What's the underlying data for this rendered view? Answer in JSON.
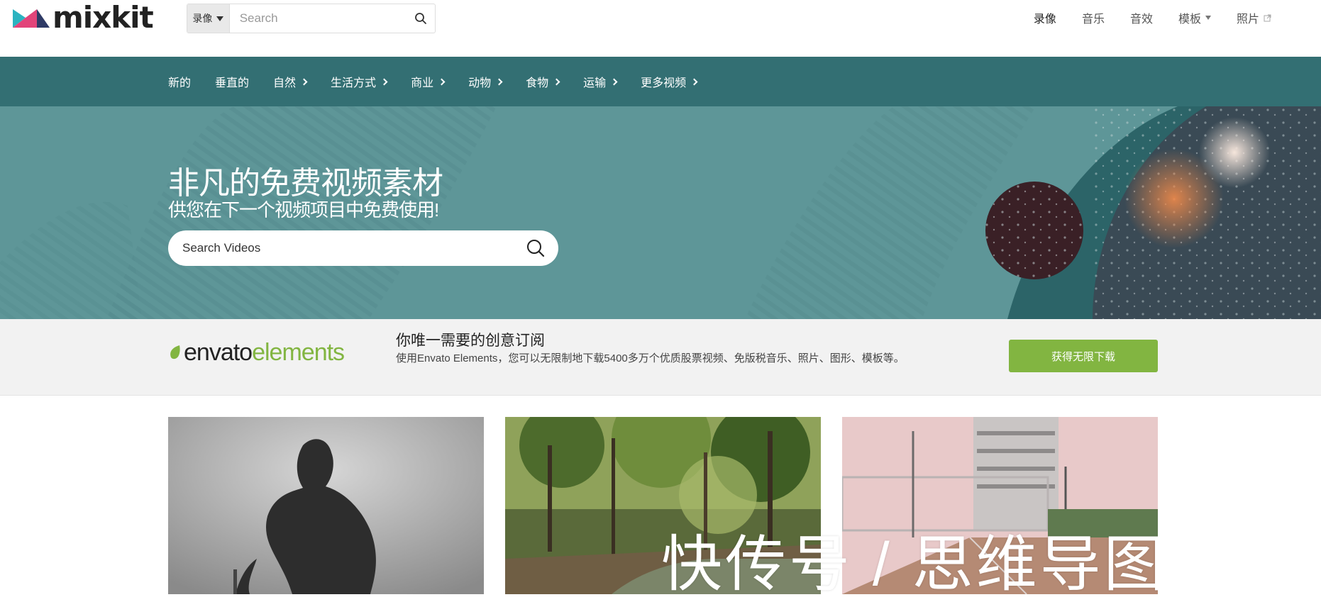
{
  "brand": {
    "name": "mixkit"
  },
  "header": {
    "search": {
      "type_label": "录像",
      "placeholder": "Search"
    },
    "nav": [
      {
        "label": "录像"
      },
      {
        "label": "音乐"
      },
      {
        "label": "音效"
      },
      {
        "label": "模板"
      },
      {
        "label": "照片"
      }
    ]
  },
  "categories": [
    {
      "label": "新的"
    },
    {
      "label": "垂直的"
    },
    {
      "label": "自然"
    },
    {
      "label": "生活方式"
    },
    {
      "label": "商业"
    },
    {
      "label": "动物"
    },
    {
      "label": "食物"
    },
    {
      "label": "运输"
    },
    {
      "label": "更多视频"
    }
  ],
  "hero": {
    "title": "非凡的免费视频素材",
    "subtitle": "供您在下一个视频项目中免费使用!",
    "search_placeholder": "Search Videos"
  },
  "promo": {
    "logo_part1": "envato",
    "logo_part2": "elements",
    "title": "你唯一需要的创意订阅",
    "description": "使用Envato Elements，您可以无限制地下载5400多万个优质股票视频、免版税音乐、照片、图形、模板等。",
    "button_label": "获得无限下载"
  },
  "watermark": {
    "text": "快传号 / 思维导图"
  },
  "colors": {
    "nav_bar": "#336f73",
    "hero_bg": "#5e9698",
    "accent_green": "#82b541",
    "promo_bg": "#f2f2f2"
  },
  "icons": [
    "search-icon",
    "chevron-right-icon",
    "dropdown-caret-icon",
    "external-link-icon",
    "envato-leaf-icon"
  ]
}
